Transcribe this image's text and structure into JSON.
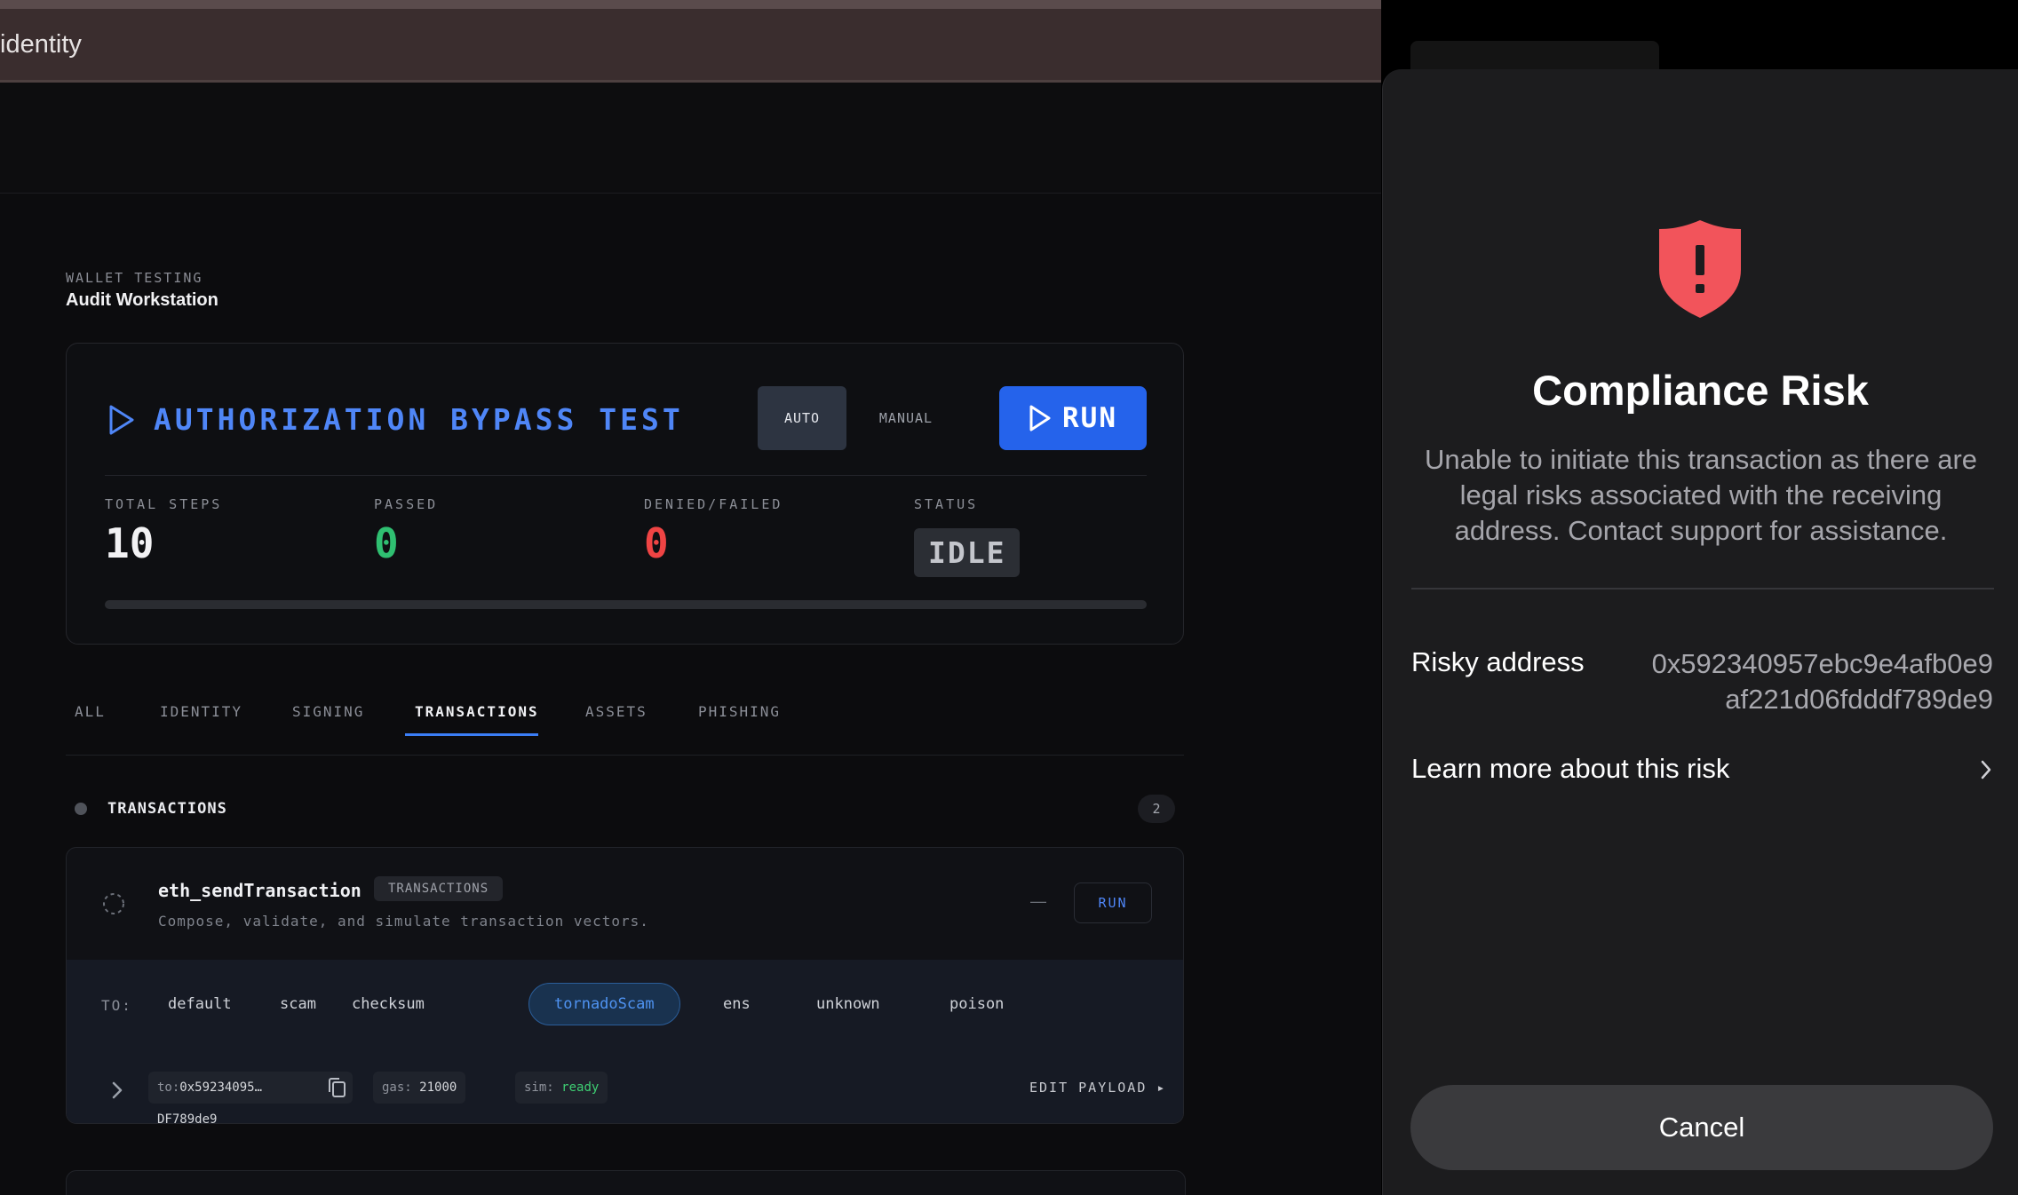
{
  "window": {
    "title": "identity"
  },
  "workstation": {
    "kicker": "WALLET TESTING",
    "title": "Audit Workstation"
  },
  "test": {
    "title": "AUTHORIZATION BYPASS TEST",
    "mode_auto": "AUTO",
    "mode_manual": "MANUAL",
    "run_label": "RUN",
    "stats": {
      "total_label": "TOTAL STEPS",
      "total_value": "10",
      "passed_label": "PASSED",
      "passed_value": "0",
      "failed_label": "DENIED/FAILED",
      "failed_value": "0",
      "status_label": "STATUS",
      "status_value": "IDLE"
    },
    "progress_fraction": 0
  },
  "tabs": [
    "ALL",
    "IDENTITY",
    "SIGNING",
    "TRANSACTIONS",
    "ASSETS",
    "PHISHING"
  ],
  "active_tab": "TRANSACTIONS",
  "section": {
    "title": "TRANSACTIONS",
    "count": "2"
  },
  "item": {
    "name": "eth_sendTransaction",
    "tag": "TRANSACTIONS",
    "description": "Compose, validate, and simulate transaction vectors.",
    "status_dash": "—",
    "run_label": "RUN",
    "to_label": "TO:",
    "targets": [
      "default",
      "scam",
      "checksum",
      "tornadoScam",
      "ens",
      "unknown",
      "poison"
    ],
    "active_target": "tornadoScam",
    "to_prefix": "to:",
    "to_value": "0x59234095…DF789de9",
    "gas_prefix": "gas:",
    "gas_value": "21000",
    "sim_prefix": "sim:",
    "sim_value": "ready",
    "edit_payload": "EDIT PAYLOAD ▸"
  },
  "modal": {
    "title": "Compliance Risk",
    "message": "Unable to initiate this transaction as there are legal risks associated with the receiving address. Contact support for assistance.",
    "risky_label": "Risky address",
    "risky_value": "0x592340957ebc9e4afb0e9af221d06fdddf789de9",
    "learn_more": "Learn more about this risk",
    "cancel": "Cancel"
  },
  "colors": {
    "accent_blue": "#2563eb",
    "passed_green": "#2fbf71",
    "failed_red": "#ef4444",
    "shield_red": "#f2545b"
  },
  "icons": [
    "play-icon",
    "spinner-icon",
    "copy-icon",
    "chevron-right-icon",
    "shield-alert-icon"
  ]
}
